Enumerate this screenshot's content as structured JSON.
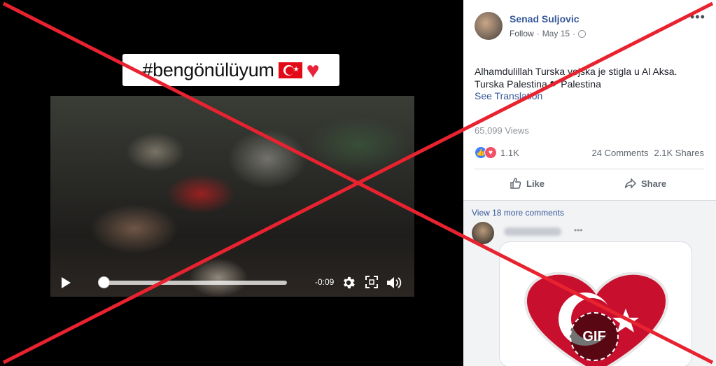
{
  "video": {
    "hashtag": "#bengönülüyum",
    "flag_icon": "turkey-flag-icon",
    "heart_icon": "red-heart-icon",
    "time_remaining": "-0:09",
    "progress": 0.02
  },
  "post": {
    "author": "Senad Suljovic",
    "follow_label": "Follow",
    "date": "May 15",
    "separator": "·",
    "more_icon": "•••",
    "text_line1": "Alhamdulillah Turska vojska je stigla u Al Aksa.",
    "text_line2": "Turska Palestina ❤ Palestina",
    "see_translation": "See Translation",
    "views": "65,099 Views",
    "reaction_count": "1.1K",
    "comments_count": "24 Comments",
    "shares_count": "2.1K Shares",
    "like_label": "Like",
    "share_label": "Share"
  },
  "comments": {
    "view_more": "View 18 more comments",
    "more_icon": "•••",
    "gif_badge": "GIF"
  },
  "colors": {
    "link": "#365899",
    "overlay_x": "#e8232f",
    "heart": "#c8102e"
  }
}
